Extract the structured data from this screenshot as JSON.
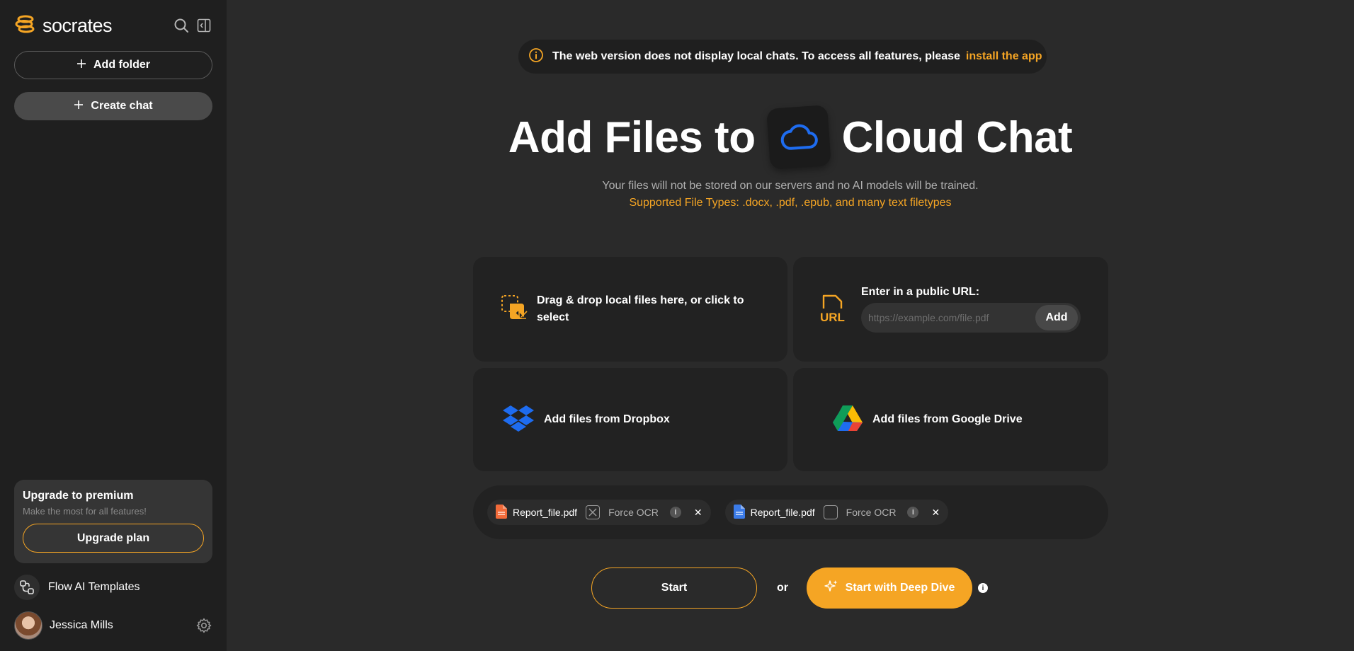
{
  "sidebar": {
    "brand": "socrates",
    "add_folder_label": "Add folder",
    "create_chat_label": "Create chat",
    "upgrade": {
      "title": "Upgrade to premium",
      "subtitle": "Make the most for all features!",
      "button_label": "Upgrade plan"
    },
    "flow_templates_label": "Flow AI Templates",
    "user_name": "Jessica Mills"
  },
  "notice": {
    "text": "The web version does not display local chats. To access all features, please",
    "link": "install the app"
  },
  "hero": {
    "title_left": "Add Files to",
    "title_right": "Cloud Chat"
  },
  "subtitle": "Your files will not be stored on our servers and no AI models will be trained.",
  "supported_types": "Supported File Types: .docx, .pdf, .epub, and many text filetypes",
  "upload": {
    "drag_text": "Drag & drop local files here, or click to select",
    "url_icon_text": "URL",
    "url_label": "Enter in a public URL:",
    "url_placeholder": "https://example.com/file.pdf",
    "url_value": "",
    "url_add_label": "Add",
    "dropbox_label": "Add files from Dropbox",
    "gdrive_label": "Add files from Google Drive"
  },
  "files": [
    {
      "name": "Report_file.pdf",
      "type": "pdf",
      "force_ocr": true,
      "ocr_label": "Force OCR"
    },
    {
      "name": "Report_file.pdf",
      "type": "doc",
      "force_ocr": false,
      "ocr_label": "Force OCR"
    }
  ],
  "actions": {
    "start_label": "Start",
    "or_label": "or",
    "deep_dive_label": "Start with Deep Dive"
  },
  "colors": {
    "accent": "#f5a524",
    "background": "#2a2a2a",
    "sidebar": "#1f1f1f",
    "cloud_blue": "#1e6cf0"
  }
}
